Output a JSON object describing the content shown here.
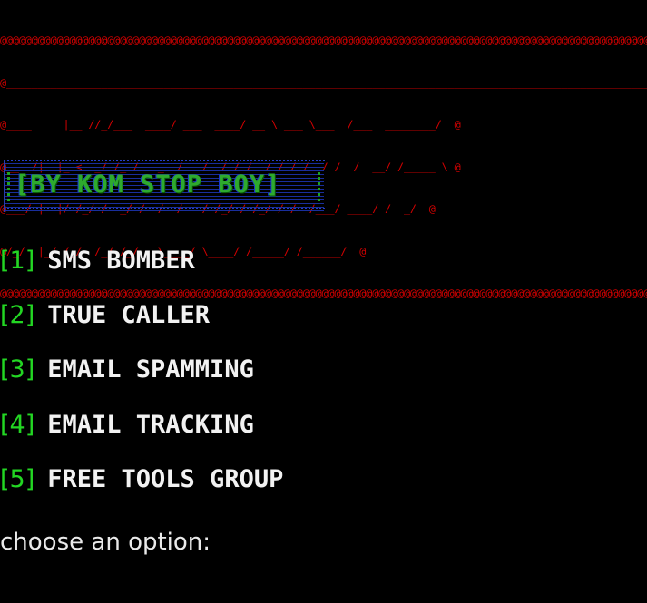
{
  "banner": {
    "lines": [
      "@@@@@@@@@@@@@@@@@@@@@@@@@@@@@@@@@@@@@@@@@@@@@@@@@@@@@@@@@@@@@@@@@@@@@@@@@@@@@@@@@@@@@@@@@@@@@@@@@@@@@@@@@@@@@@@@@",
      "@_____________________________________________________________________________________________________________@",
      "@____     |__ //_/___  ____/ ___  ____/ __ \\ ___ \\___  /___  ________/  @",
      "@__  /|  |_ <  _/ /_ /   _  /   /  / / /  / / / /  / /  /  __/ /_____ \\ @",
      "@___/ |  |/ /_/ /  _/ /  /  /   / /_/ / /_/ / /  /___/ ____/ /  _/  @",
      "@/_/  |_/ /_/  /_/ /_/   \\____/ \\____/ /_____/ /______/  @",
      "@@@@@@@@@@@@@@@@@@@@@@@@@@@@@@@@@@@@@@@@@@@@@@@@@@@@@@@@@@@@@@@@@@@@@@@@@@@@@@@@@@@@@@@@@@@@@@@@@@@@@@@@@@@@@@@@"
    ]
  },
  "subtitle": "[BY KOM STOP BOY]",
  "menu": {
    "items": [
      {
        "index": "[1]",
        "label": "SMS BOMBER"
      },
      {
        "index": "[2]",
        "label": "TRUE CALLER"
      },
      {
        "index": "[3]",
        "label": "EMAIL SPAMMING"
      },
      {
        "index": "[4]",
        "label": "EMAIL TRACKING"
      },
      {
        "index": "[5]",
        "label": "FREE TOOLS GROUP"
      }
    ]
  },
  "prompt": "choose an option:",
  "colors": {
    "background": "#000000",
    "banner": "#d40000",
    "index": "#23d623",
    "label": "#f2f2f2",
    "subtitle": "#2fae2f",
    "subtitle_box": "#2540d0"
  }
}
